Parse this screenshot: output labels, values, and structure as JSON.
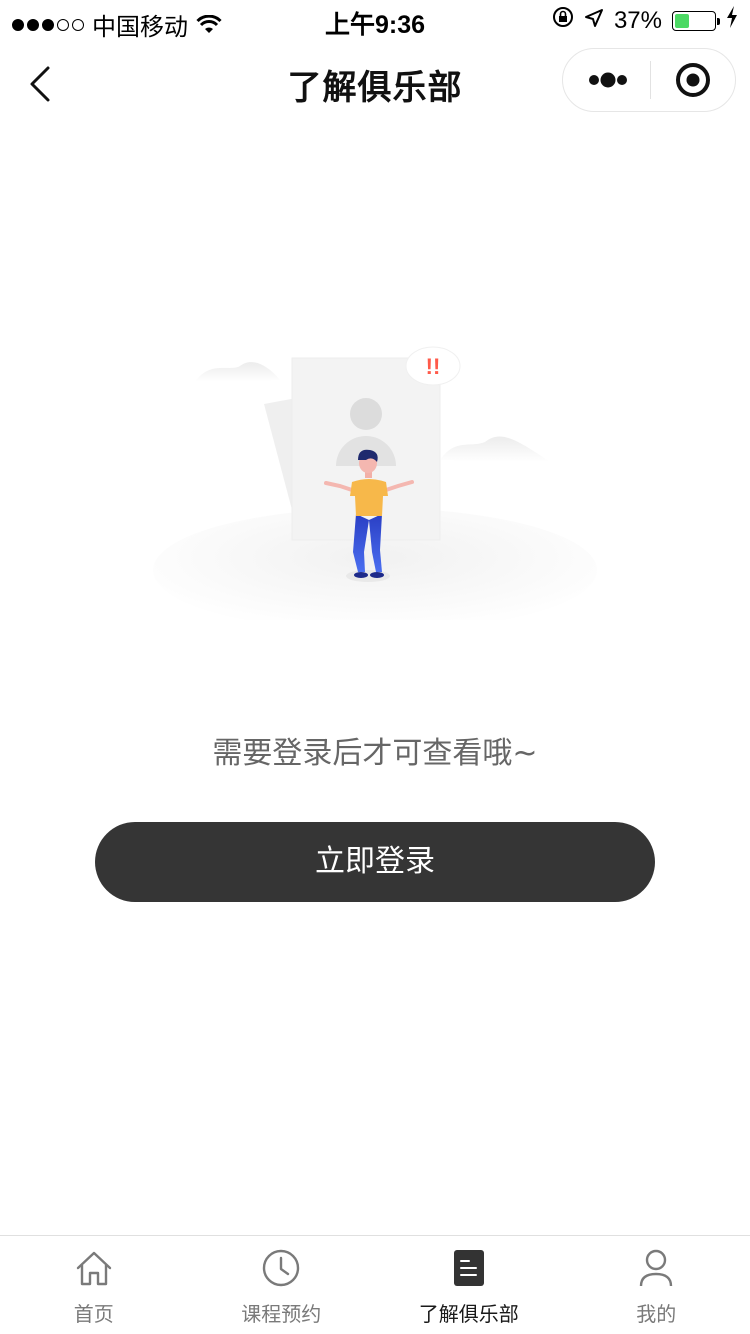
{
  "status_bar": {
    "carrier": "中国移动",
    "time": "上午9:36",
    "battery_percent": "37%",
    "battery_level": 0.37,
    "signal_bars_filled": 3,
    "signal_bars_total": 5
  },
  "nav": {
    "title": "了解俱乐部",
    "back_icon": "chevron-left-icon",
    "more_icon": "more-dots-icon",
    "close_icon": "target-close-icon"
  },
  "illustration": {
    "badge_text": "!!"
  },
  "content": {
    "tip": "需要登录后才可查看哦~",
    "login_button": "立即登录"
  },
  "tabs": [
    {
      "label": "首页",
      "icon": "home-icon",
      "active": false
    },
    {
      "label": "课程预约",
      "icon": "clock-icon",
      "active": false
    },
    {
      "label": "了解俱乐部",
      "icon": "document-icon",
      "active": true
    },
    {
      "label": "我的",
      "icon": "user-icon",
      "active": false
    }
  ],
  "colors": {
    "button_bg": "#353535",
    "battery_green": "#4cd964",
    "badge_red": "#ff5a4a",
    "shirt_yellow": "#f7b84a",
    "pants_blue": "#3155d8"
  }
}
